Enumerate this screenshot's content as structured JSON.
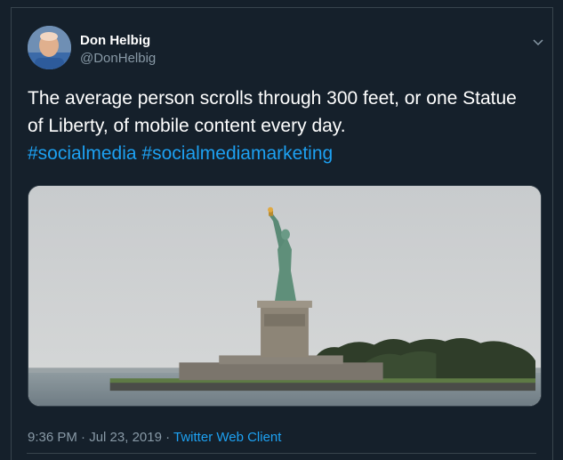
{
  "author": {
    "name": "Don Helbig",
    "handle": "@DonHelbig",
    "avatar_icon": "profile-photo"
  },
  "tweet": {
    "text": "The average person scrolls through 300 feet, or one Statue of Liberty, of mobile content every day.",
    "hashtags": [
      "#socialmedia",
      "#socialmediamarketing"
    ],
    "media_icon": "statue-of-liberty-photo"
  },
  "meta": {
    "time": "9:36 PM",
    "separator1": " · ",
    "date": "Jul 23, 2019",
    "separator2": " · ",
    "client": "Twitter Web Client"
  },
  "colors": {
    "background": "#15202b",
    "accent": "#1da1f2",
    "secondary_text": "#8899a6",
    "border": "#38444d"
  },
  "caret_icon": "chevron-down-icon"
}
